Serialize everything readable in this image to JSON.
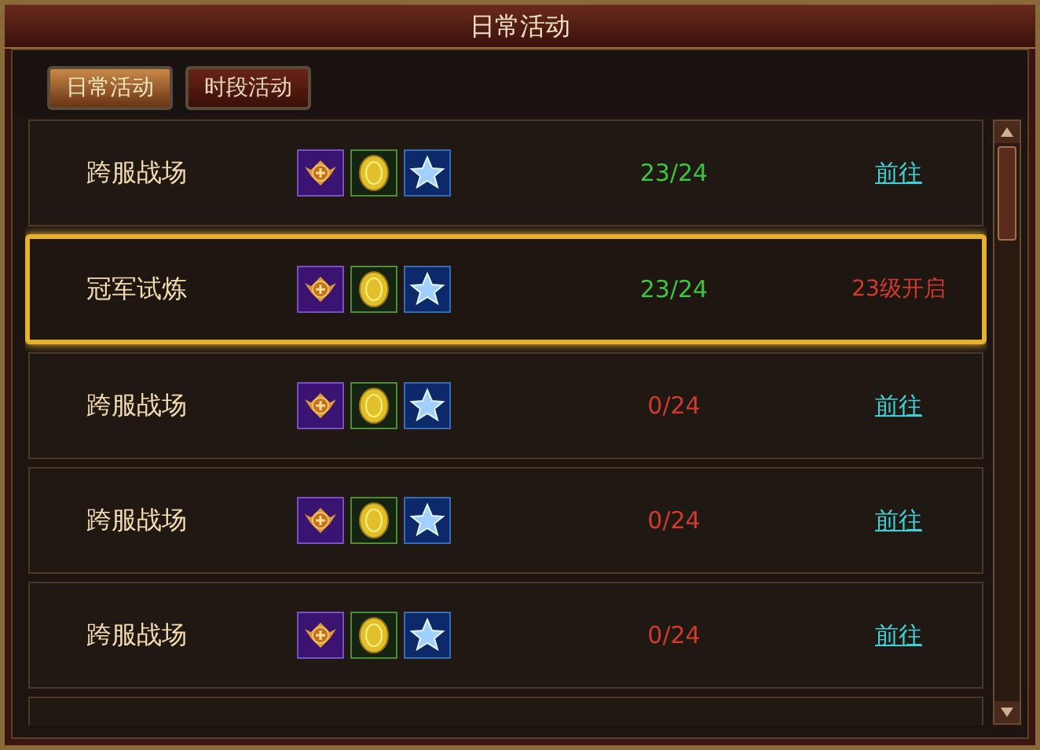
{
  "window": {
    "title": "日常活动"
  },
  "tabs": [
    {
      "label": "日常活动",
      "selected": true
    },
    {
      "label": "时段活动",
      "selected": false
    }
  ],
  "activities": [
    {
      "name": "跨服战场",
      "progress": "23/24",
      "color": "#3ec43e",
      "selected": false,
      "action": {
        "kind": "link",
        "text": "前往"
      }
    },
    {
      "name": "冠军试炼",
      "progress": "23/24",
      "color": "#3ec43e",
      "selected": true,
      "action": {
        "kind": "notice",
        "text": "23级开启"
      }
    },
    {
      "name": "跨服战场",
      "progress": "0/24",
      "color": "#d23a2e",
      "selected": false,
      "action": {
        "kind": "link",
        "text": "前往"
      }
    },
    {
      "name": "跨服战场",
      "progress": "0/24",
      "color": "#d23a2e",
      "selected": false,
      "action": {
        "kind": "link",
        "text": "前往"
      }
    },
    {
      "name": "跨服战场",
      "progress": "0/24",
      "color": "#d23a2e",
      "selected": false,
      "action": {
        "kind": "link",
        "text": "前往"
      }
    }
  ]
}
